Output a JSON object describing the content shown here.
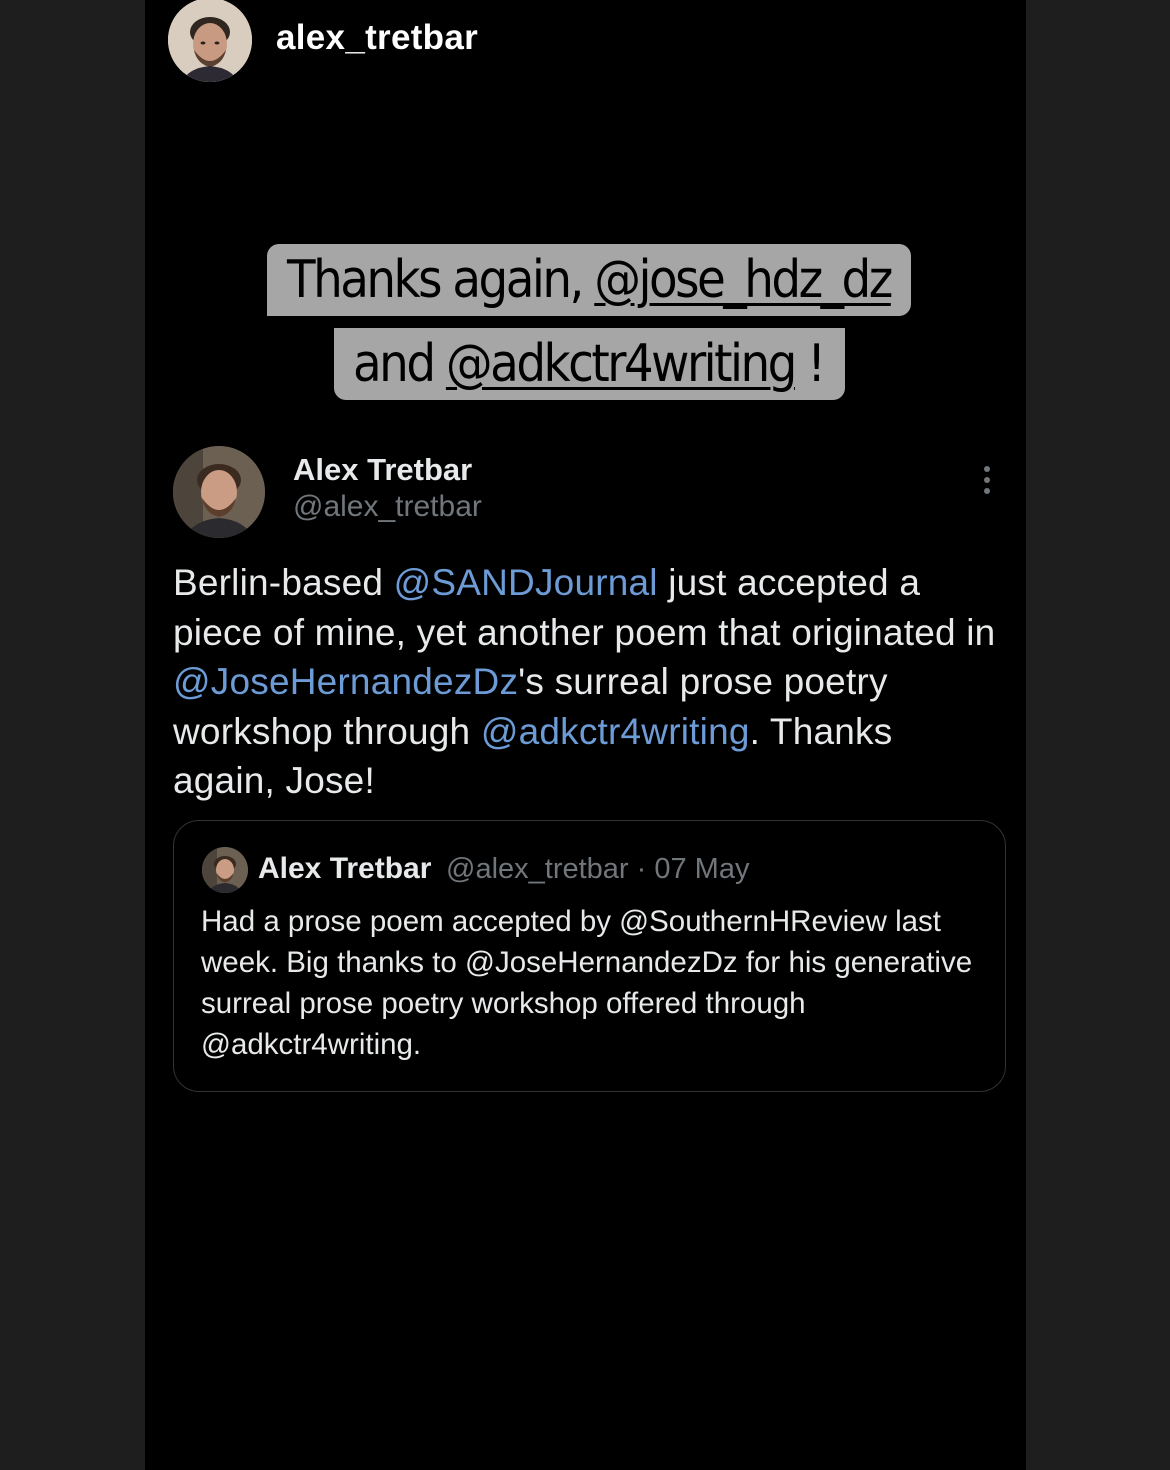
{
  "story": {
    "username": "alex_tretbar",
    "avatar_icon": "profile-photo"
  },
  "caption": {
    "line1_prefix": "Thanks again, ",
    "line1_tag": "@jose_hdz_dz",
    "line2_prefix": "and ",
    "line2_tag": "@adkctr4writing",
    "line2_suffix": " !"
  },
  "tweet": {
    "author_name": "Alex Tretbar",
    "author_handle": "@alex_tretbar",
    "text_parts": [
      "Berlin-based ",
      "@SANDJournal",
      " just accepted a piece of mine, yet another poem that originated in ",
      "@JoseHernandezDz",
      "'s surreal prose poetry workshop through ",
      "@adkctr4writing",
      ". Thanks again, Jose!"
    ],
    "more_icon": "more-vertical-icon"
  },
  "quoted_tweet": {
    "author_name": "Alex Tretbar",
    "meta": "@alex_tretbar · 07 May",
    "text": "Had a prose poem accepted by @SouthernHReview last week. Big thanks to @JoseHernandezDz for his generative surreal prose poetry workshop offered through @adkctr4writing."
  },
  "colors": {
    "background": "#1e1e1e",
    "story_background": "#000000",
    "caption_background": "#a6a6a6",
    "mention": "#6c9bd6",
    "secondary_text": "#71767b",
    "primary_text": "#e7e9ea"
  }
}
